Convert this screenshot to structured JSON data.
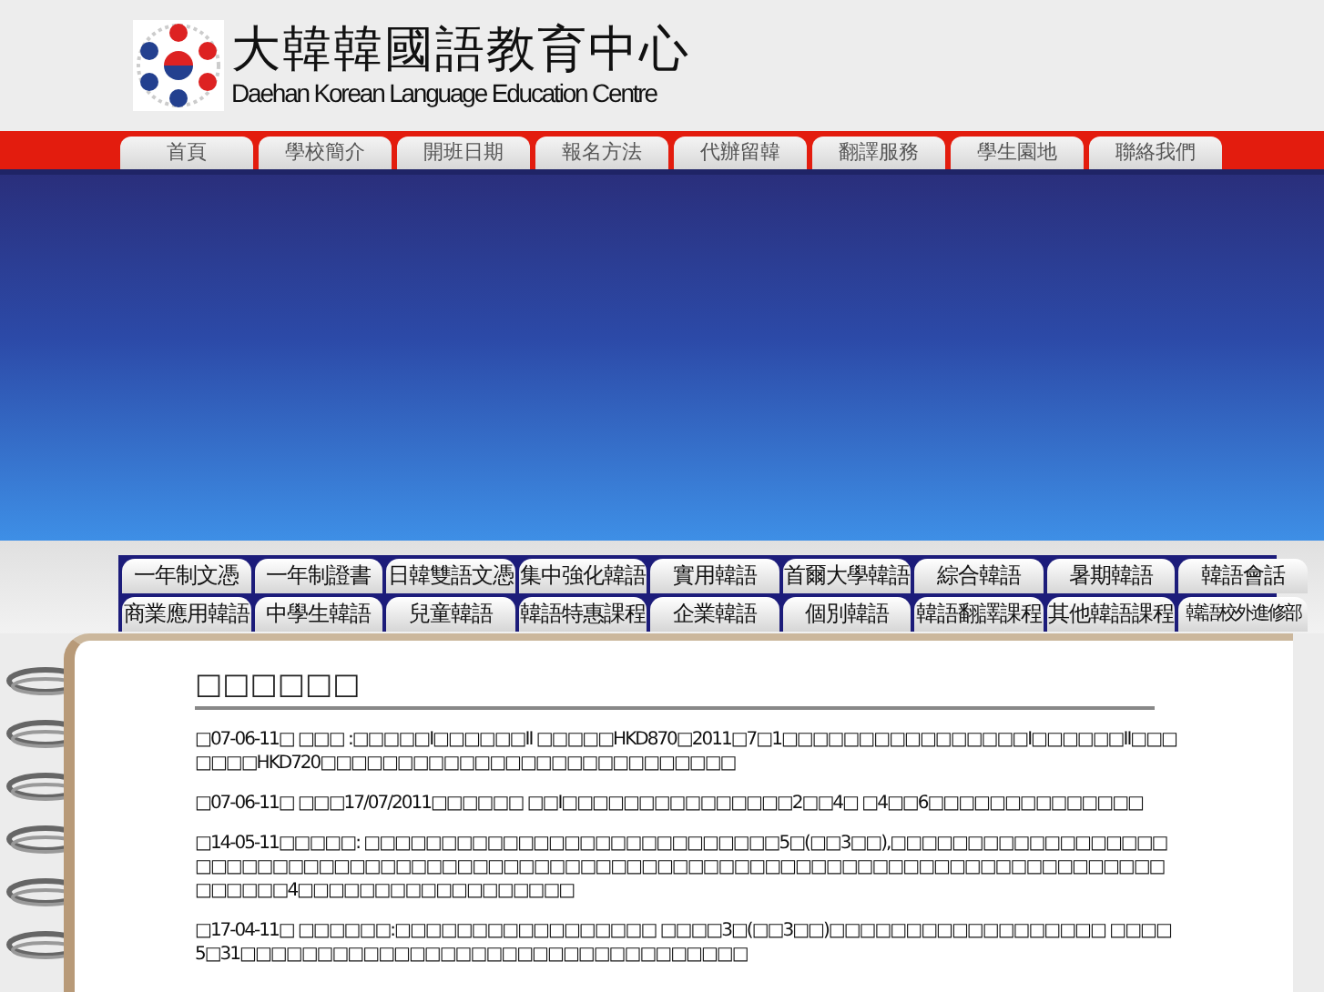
{
  "header": {
    "title": "大韓韓國語教育中心",
    "subtitle": "Daehan Korean Language Education Centre"
  },
  "nav": [
    "首頁",
    "學校簡介",
    "開班日期",
    "報名方法",
    "代辦留韓",
    "翻譯服務",
    "學生園地",
    "聯絡我們"
  ],
  "course_rows": [
    [
      "一年制文憑",
      "一年制證書",
      "日韓雙語文憑",
      "集中強化韓語",
      "實用韓語",
      "首爾大學韓語",
      "綜合韓語",
      "暑期韓語",
      "韓語會話"
    ],
    [
      "商業應用韓語",
      "中學生韓語",
      "兒童韓語",
      "韓語特惠課程",
      "企業韓語",
      "個別韓語",
      "韓語翻譯課程",
      "其他韓語課程",
      "韓語校外進修部"
    ]
  ],
  "news": {
    "heading": "□□□□□□",
    "items": [
      "□07-06-11□ □□□ :□□□□□I□□□□□□II □□□□□HKD870□2011□7□1□□□□□□□□□□□□□□□□I□□□□□□II□□□□□□□HKD720□□□□□□□□□□□□□□□□□□□□□□□□□□□",
      "□07-06-11□ □□□17/07/2011□□□□□□ □□I□□□□□□□□□□□□□□□2□□4□ □4□□6□□□□□□□□□□□□□□",
      "□14-05-11□□□□□: □□□□□□□□□□□□□□□□□□□□□□□□□□□5□(□□3□□),□□□□□□□□□□□□□□□□□□□□□□□□□□□□□□□□□□□□□□□□□□□□□□□□□□□□□□□□□□□□□□□□□□□□□□□□□□□□□□□□□□□□□□□4□□□□□□□□□□□□□□□□□□",
      "□17-04-11□ □□□□□□:□□□□□□□□□□□□□□□□□ □□□□3□(□□3□□)□□□□□□□□□□□□□□□□□□ □□□□5□31□□□□□□□□□□□□□□□□□□□□□□□□□□□□□□□□□"
    ]
  }
}
